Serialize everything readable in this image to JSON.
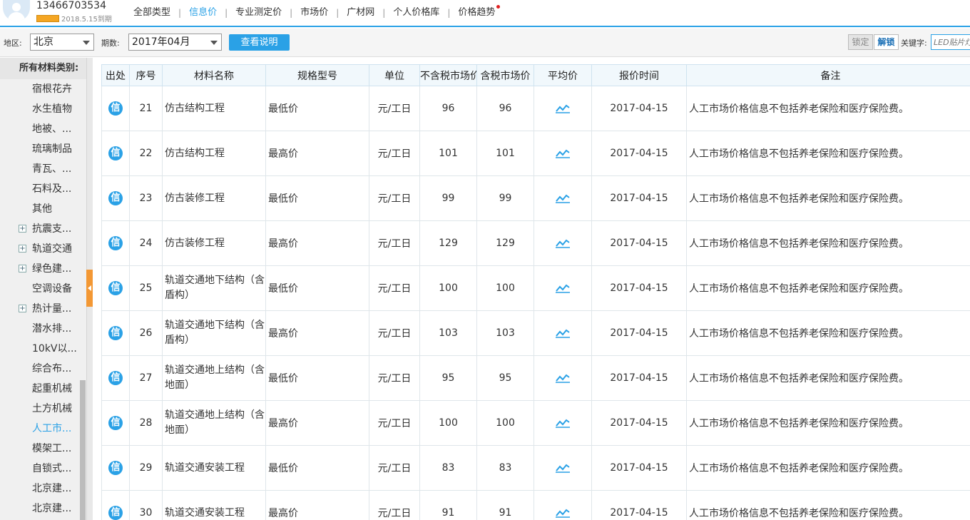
{
  "user": {
    "phone": "13466703534",
    "expiry": "2018.5.15到期"
  },
  "nav": [
    {
      "label": "全部类型",
      "active": false
    },
    {
      "label": "信息价",
      "active": true
    },
    {
      "label": "专业测定价",
      "active": false
    },
    {
      "label": "市场价",
      "active": false
    },
    {
      "label": "广材网",
      "active": false
    },
    {
      "label": "个人价格库",
      "active": false
    },
    {
      "label": "价格趋势",
      "active": false,
      "dot": true
    }
  ],
  "filter": {
    "region_label": "地区:",
    "region_value": "北京",
    "period_label": "期数:",
    "period_value": "2017年04月",
    "explain_button": "查看说明",
    "lock_button": "锁定",
    "unlock_button": "解锁",
    "keyword_label": "关键字:",
    "keyword_placeholder": "LED贴片灯"
  },
  "sidebar": {
    "title": "所有材料类别:",
    "items": [
      {
        "label": "宿根花卉",
        "expandable": false
      },
      {
        "label": "水生植物",
        "expandable": false
      },
      {
        "label": "地被、...",
        "expandable": false
      },
      {
        "label": "琉璃制品",
        "expandable": false
      },
      {
        "label": "青瓦、...",
        "expandable": false
      },
      {
        "label": "石料及...",
        "expandable": false
      },
      {
        "label": "其他",
        "expandable": false
      },
      {
        "label": "抗震支...",
        "expandable": true
      },
      {
        "label": "轨道交通",
        "expandable": true
      },
      {
        "label": "绿色建...",
        "expandable": true
      },
      {
        "label": "空调设备",
        "expandable": false
      },
      {
        "label": "热计量...",
        "expandable": true
      },
      {
        "label": "潜水排...",
        "expandable": false
      },
      {
        "label": "10kV以...",
        "expandable": false
      },
      {
        "label": "综合布...",
        "expandable": false
      },
      {
        "label": "起重机械",
        "expandable": false
      },
      {
        "label": "土方机械",
        "expandable": false
      },
      {
        "label": "人工市...",
        "expandable": false,
        "active": true
      },
      {
        "label": "模架工...",
        "expandable": false
      },
      {
        "label": "自锁式...",
        "expandable": false
      },
      {
        "label": "北京建...",
        "expandable": false
      },
      {
        "label": "北京建...",
        "expandable": false
      }
    ]
  },
  "table": {
    "headers": [
      "出处",
      "序号",
      "材料名称",
      "规格型号",
      "单位",
      "不含税市场价",
      "含税市场价",
      "平均价",
      "报价时间",
      "备注"
    ],
    "source_icon_text": "信",
    "rows": [
      {
        "seq": "21",
        "name": "仿古结构工程",
        "spec": "最低价",
        "unit": "元/工日",
        "price_ex": "96",
        "price_in": "96",
        "date": "2017-04-15",
        "note": "人工市场价格信息不包括养老保险和医疗保险费。"
      },
      {
        "seq": "22",
        "name": "仿古结构工程",
        "spec": "最高价",
        "unit": "元/工日",
        "price_ex": "101",
        "price_in": "101",
        "date": "2017-04-15",
        "note": "人工市场价格信息不包括养老保险和医疗保险费。"
      },
      {
        "seq": "23",
        "name": "仿古装修工程",
        "spec": "最低价",
        "unit": "元/工日",
        "price_ex": "99",
        "price_in": "99",
        "date": "2017-04-15",
        "note": "人工市场价格信息不包括养老保险和医疗保险费。"
      },
      {
        "seq": "24",
        "name": "仿古装修工程",
        "spec": "最高价",
        "unit": "元/工日",
        "price_ex": "129",
        "price_in": "129",
        "date": "2017-04-15",
        "note": "人工市场价格信息不包括养老保险和医疗保险费。"
      },
      {
        "seq": "25",
        "name": "轨道交通地下结构（含盾构）",
        "spec": "最低价",
        "unit": "元/工日",
        "price_ex": "100",
        "price_in": "100",
        "date": "2017-04-15",
        "note": "人工市场价格信息不包括养老保险和医疗保险费。"
      },
      {
        "seq": "26",
        "name": "轨道交通地下结构（含盾构）",
        "spec": "最高价",
        "unit": "元/工日",
        "price_ex": "103",
        "price_in": "103",
        "date": "2017-04-15",
        "note": "人工市场价格信息不包括养老保险和医疗保险费。"
      },
      {
        "seq": "27",
        "name": "轨道交通地上结构（含地面）",
        "spec": "最低价",
        "unit": "元/工日",
        "price_ex": "95",
        "price_in": "95",
        "date": "2017-04-15",
        "note": "人工市场价格信息不包括养老保险和医疗保险费。"
      },
      {
        "seq": "28",
        "name": "轨道交通地上结构（含地面）",
        "spec": "最高价",
        "unit": "元/工日",
        "price_ex": "100",
        "price_in": "100",
        "date": "2017-04-15",
        "note": "人工市场价格信息不包括养老保险和医疗保险费。"
      },
      {
        "seq": "29",
        "name": "轨道交通安装工程",
        "spec": "最低价",
        "unit": "元/工日",
        "price_ex": "83",
        "price_in": "83",
        "date": "2017-04-15",
        "note": "人工市场价格信息不包括养老保险和医疗保险费。"
      },
      {
        "seq": "30",
        "name": "轨道交通安装工程",
        "spec": "最高价",
        "unit": "元/工日",
        "price_ex": "91",
        "price_in": "91",
        "date": "2017-04-15",
        "note": "人工市场价格信息不包括养老保险和医疗保险费。"
      }
    ]
  },
  "colors": {
    "accent": "#2aa1e6",
    "collapse_tab": "#f39834",
    "badge_dot": "#e02020"
  }
}
